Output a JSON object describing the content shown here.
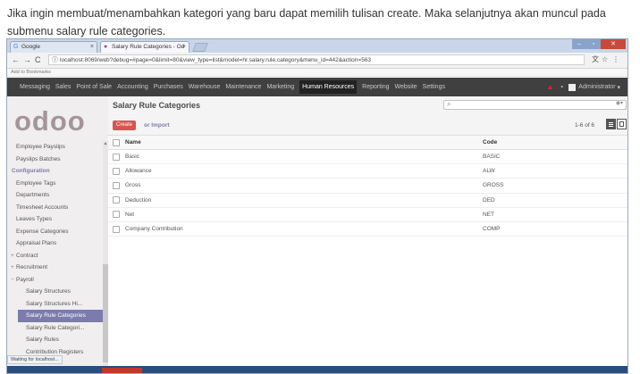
{
  "caption": "Jika ingin membuat/menambahkan kategori yang baru dapat memilih tulisan create. Maka selanjutnya akan muncul pada submenu salary rule categories.",
  "browser": {
    "tabs": [
      {
        "label": "Google",
        "icon": "google-icon"
      },
      {
        "label": "Salary Rule Categories - Od",
        "icon": "odoo-tab-icon"
      }
    ],
    "url": "localhost:8069/web?debug=#page=0&limit=80&view_type=list&model=hr.salary.rule.category&menu_id=442&action=563",
    "bookmarks_label": "Add to Bookmarks",
    "status_text": "Waiting for localhost..."
  },
  "topnav": {
    "items": [
      "Messaging",
      "Sales",
      "Point of Sale",
      "Accounting",
      "Purchases",
      "Warehouse",
      "Maintenance",
      "Marketing",
      "Human Resources",
      "Reporting",
      "Website",
      "Settings"
    ],
    "active_item": "Human Resources",
    "user": "Administrator"
  },
  "logo": "odoo",
  "sidebar": {
    "items": [
      {
        "label": "Employee Payslips",
        "kind": "item"
      },
      {
        "label": "Payslips Batches",
        "kind": "item"
      },
      {
        "label": "Configuration",
        "kind": "head"
      },
      {
        "label": "Employee Tags",
        "kind": "item"
      },
      {
        "label": "Departments",
        "kind": "item"
      },
      {
        "label": "Timesheet Accounts",
        "kind": "item"
      },
      {
        "label": "Leaves Types",
        "kind": "item"
      },
      {
        "label": "Expense Categories",
        "kind": "item"
      },
      {
        "label": "Appraisal Plans",
        "kind": "item"
      },
      {
        "label": "Contract",
        "kind": "coll",
        "sign": "+"
      },
      {
        "label": "Recruitment",
        "kind": "coll",
        "sign": "+"
      },
      {
        "label": "Payroll",
        "kind": "coll",
        "sign": "−"
      },
      {
        "label": "Salary Structures",
        "kind": "sub"
      },
      {
        "label": "Salary Structures Hi...",
        "kind": "sub"
      },
      {
        "label": "Salary Rule Categories",
        "kind": "active"
      },
      {
        "label": "Salary Rule Categori...",
        "kind": "sub"
      },
      {
        "label": "Salary Rules",
        "kind": "sub"
      },
      {
        "label": "Contribution Registers",
        "kind": "sub"
      }
    ]
  },
  "main": {
    "title": "Salary Rule Categories",
    "create_label": "Create",
    "import_label": "or Import",
    "pager": "1-6 of 6",
    "columns": {
      "name": "Name",
      "code": "Code"
    },
    "rows": [
      {
        "name": "Basic",
        "code": "BASIC"
      },
      {
        "name": "Allowance",
        "code": "ALW"
      },
      {
        "name": "Gross",
        "code": "GROSS"
      },
      {
        "name": "Deduction",
        "code": "DED"
      },
      {
        "name": "Net",
        "code": "NET"
      },
      {
        "name": "Company Contribution",
        "code": "COMP"
      }
    ]
  }
}
